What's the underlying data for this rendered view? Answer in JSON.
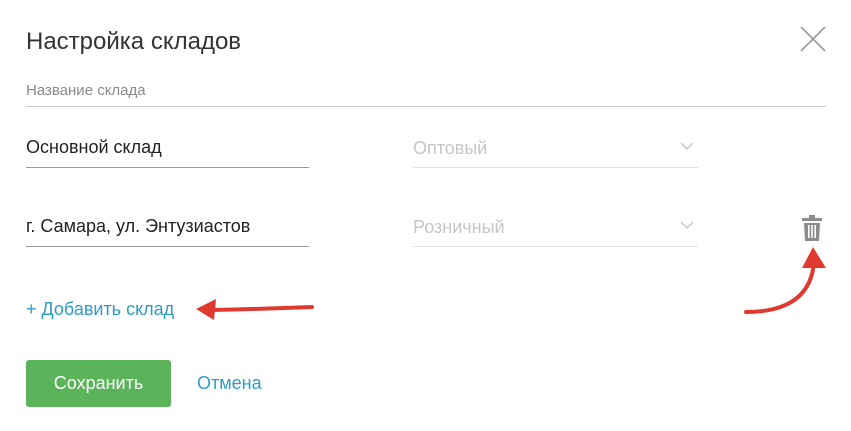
{
  "dialog": {
    "title": "Настройка складов",
    "column_label": "Название склада"
  },
  "warehouses": [
    {
      "name": "Основной склад",
      "type": "Оптовый"
    },
    {
      "name": "г. Самара, ул. Энтузиастов",
      "type": "Розничный"
    }
  ],
  "actions": {
    "add_label": "+ Добавить склад",
    "save_label": "Сохранить",
    "cancel_label": "Отмена"
  },
  "colors": {
    "accent_link": "#2e9cc6",
    "save_button": "#5bb45a",
    "annotation_arrow": "#e03a30"
  },
  "icons": {
    "close": "close-icon",
    "chevron": "chevron-down-icon",
    "delete": "trash-icon"
  }
}
